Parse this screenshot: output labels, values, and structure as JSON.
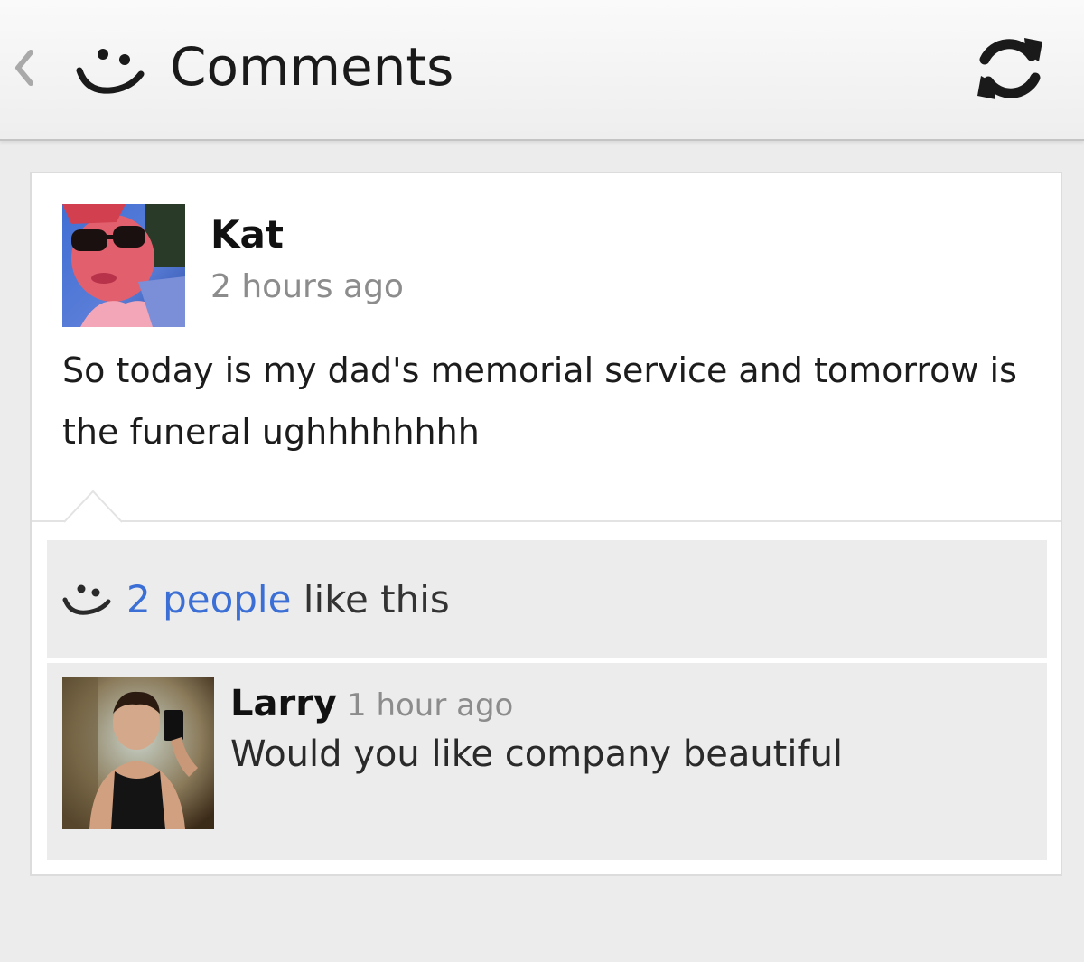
{
  "header": {
    "title": "Comments",
    "back_icon": "chevron-left-icon",
    "app_icon": "smiley-icon",
    "refresh_icon": "refresh-icon"
  },
  "post": {
    "author": "Kat",
    "timestamp": "2 hours ago",
    "body": "So today is my dad's memorial service and tomorrow is the funeral ughhhhhhhh"
  },
  "likes": {
    "link_text": "2 people",
    "suffix_text": " like this",
    "icon": "smiley-icon"
  },
  "comments": [
    {
      "author": "Larry",
      "timestamp": "1 hour ago",
      "text": "Would you like company beautiful"
    }
  ],
  "colors": {
    "link": "#3b6fd6",
    "background": "#ececec",
    "card": "#ffffff",
    "muted_text": "#8c8c8c"
  }
}
